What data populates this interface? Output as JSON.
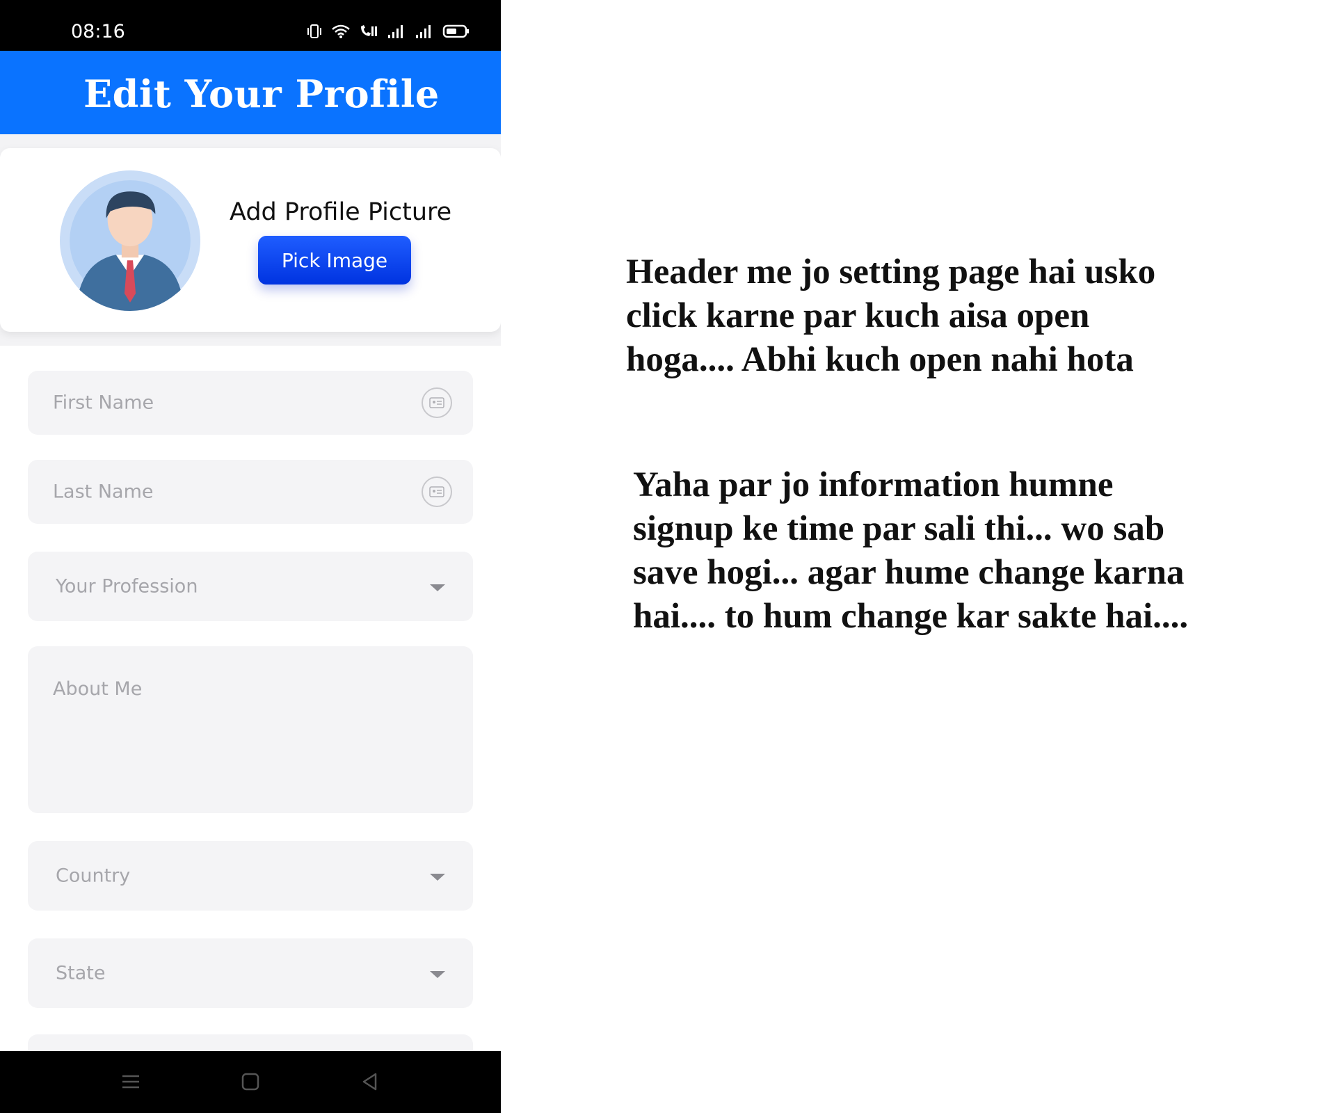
{
  "status_bar": {
    "time": "08:16"
  },
  "app_bar": {
    "title": "Edit Your Profile"
  },
  "profile": {
    "add_picture_label": "Add Profile Picture",
    "pick_image_label": "Pick Image"
  },
  "form": {
    "first_name_placeholder": "First Name",
    "last_name_placeholder": "Last Name",
    "profession_placeholder": "Your Profession",
    "about_placeholder": "About Me",
    "country_placeholder": "Country",
    "state_placeholder": "State"
  },
  "notes": {
    "note1_line1": "Header me jo setting page hai usko",
    "note1_line2": "click karne par kuch aisa open",
    "note1_line3": "hoga.... Abhi kuch open nahi hota",
    "note2_line1": "Yaha par jo information humne",
    "note2_line2": "signup ke time par sali thi... wo sab",
    "note2_line3": "save hogi... agar hume change karna",
    "note2_line4": "hai.... to hum change kar sakte hai...."
  },
  "colors": {
    "app_bar": "#0a73ff",
    "button": "#0033e0",
    "field_bg": "#f4f4f6"
  },
  "icons": [
    "vibrate-icon",
    "wifi-icon",
    "volte-call-icon",
    "signal-icon",
    "battery-icon",
    "id-card-icon",
    "dropdown-caret-icon",
    "menu-nav-icon",
    "home-nav-icon",
    "back-nav-icon"
  ]
}
